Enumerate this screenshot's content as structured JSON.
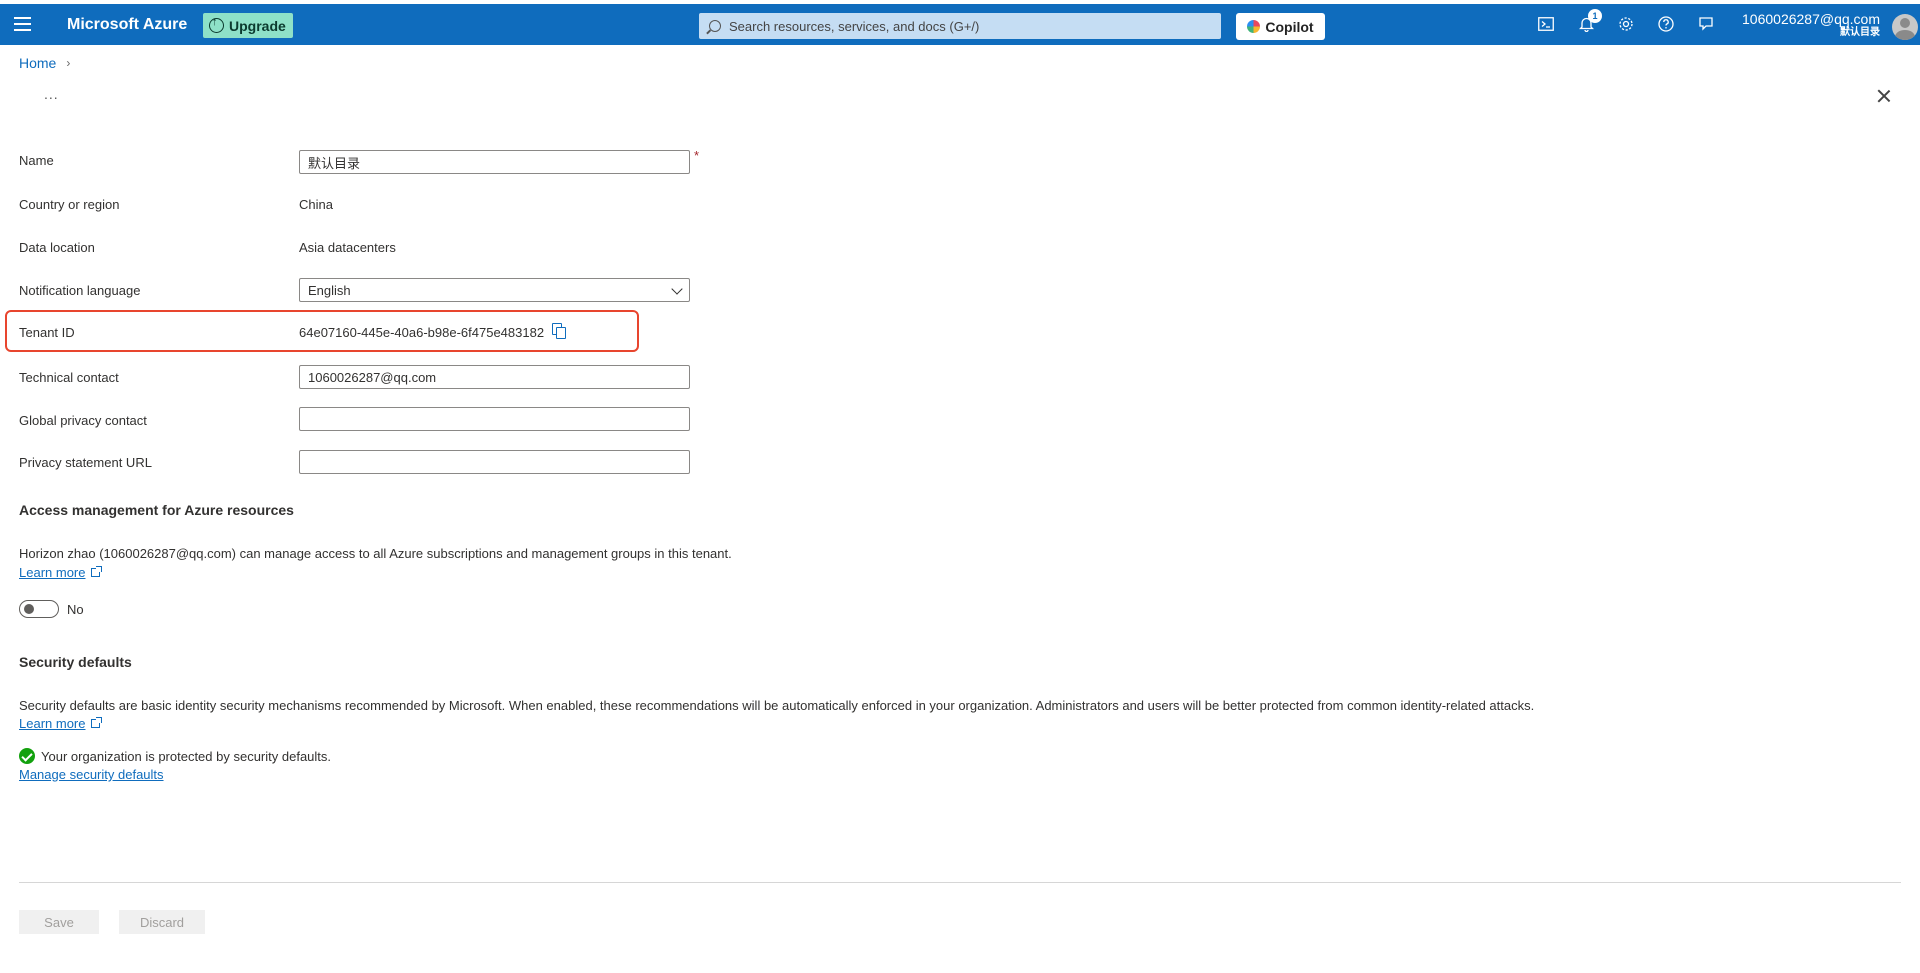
{
  "header": {
    "brand": "Microsoft Azure",
    "upgrade_label": "Upgrade",
    "search_placeholder": "Search resources, services, and docs (G+/)",
    "copilot_label": "Copilot",
    "notification_count": "1",
    "account_email": "1060026287@qq.com",
    "account_tenant": "默认目录",
    "accent_color": "#0f6cbd"
  },
  "breadcrumb": {
    "home": "Home"
  },
  "toolbar": {
    "ellipsis": "..."
  },
  "form": {
    "name_label": "Name",
    "name_value": "默认目录",
    "required_mark": "*",
    "country_label": "Country or region",
    "country_value": "China",
    "data_location_label": "Data location",
    "data_location_value": "Asia datacenters",
    "notification_language_label": "Notification language",
    "notification_language_value": "English",
    "tenant_id_label": "Tenant ID",
    "tenant_id_value": "64e07160-445e-40a6-b98e-6f475e483182",
    "technical_contact_label": "Technical contact",
    "technical_contact_value": "1060026287@qq.com",
    "global_privacy_label": "Global privacy contact",
    "global_privacy_value": "",
    "privacy_url_label": "Privacy statement URL",
    "privacy_url_value": ""
  },
  "access": {
    "title": "Access management for Azure resources",
    "description": "Horizon zhao (1060026287@qq.com) can manage access to all Azure subscriptions and management groups in this tenant.",
    "learn_more": "Learn more",
    "toggle_label": "No",
    "toggle_on": false
  },
  "security": {
    "title": "Security defaults",
    "description": "Security defaults are basic identity security mechanisms recommended by Microsoft. When enabled, these recommendations will be automatically enforced in your organization. Administrators and users will be better protected from common identity-related attacks.",
    "learn_more": "Learn more",
    "status": "Your organization is protected by security defaults.",
    "manage_link": "Manage security defaults"
  },
  "actions": {
    "save": "Save",
    "discard": "Discard"
  }
}
